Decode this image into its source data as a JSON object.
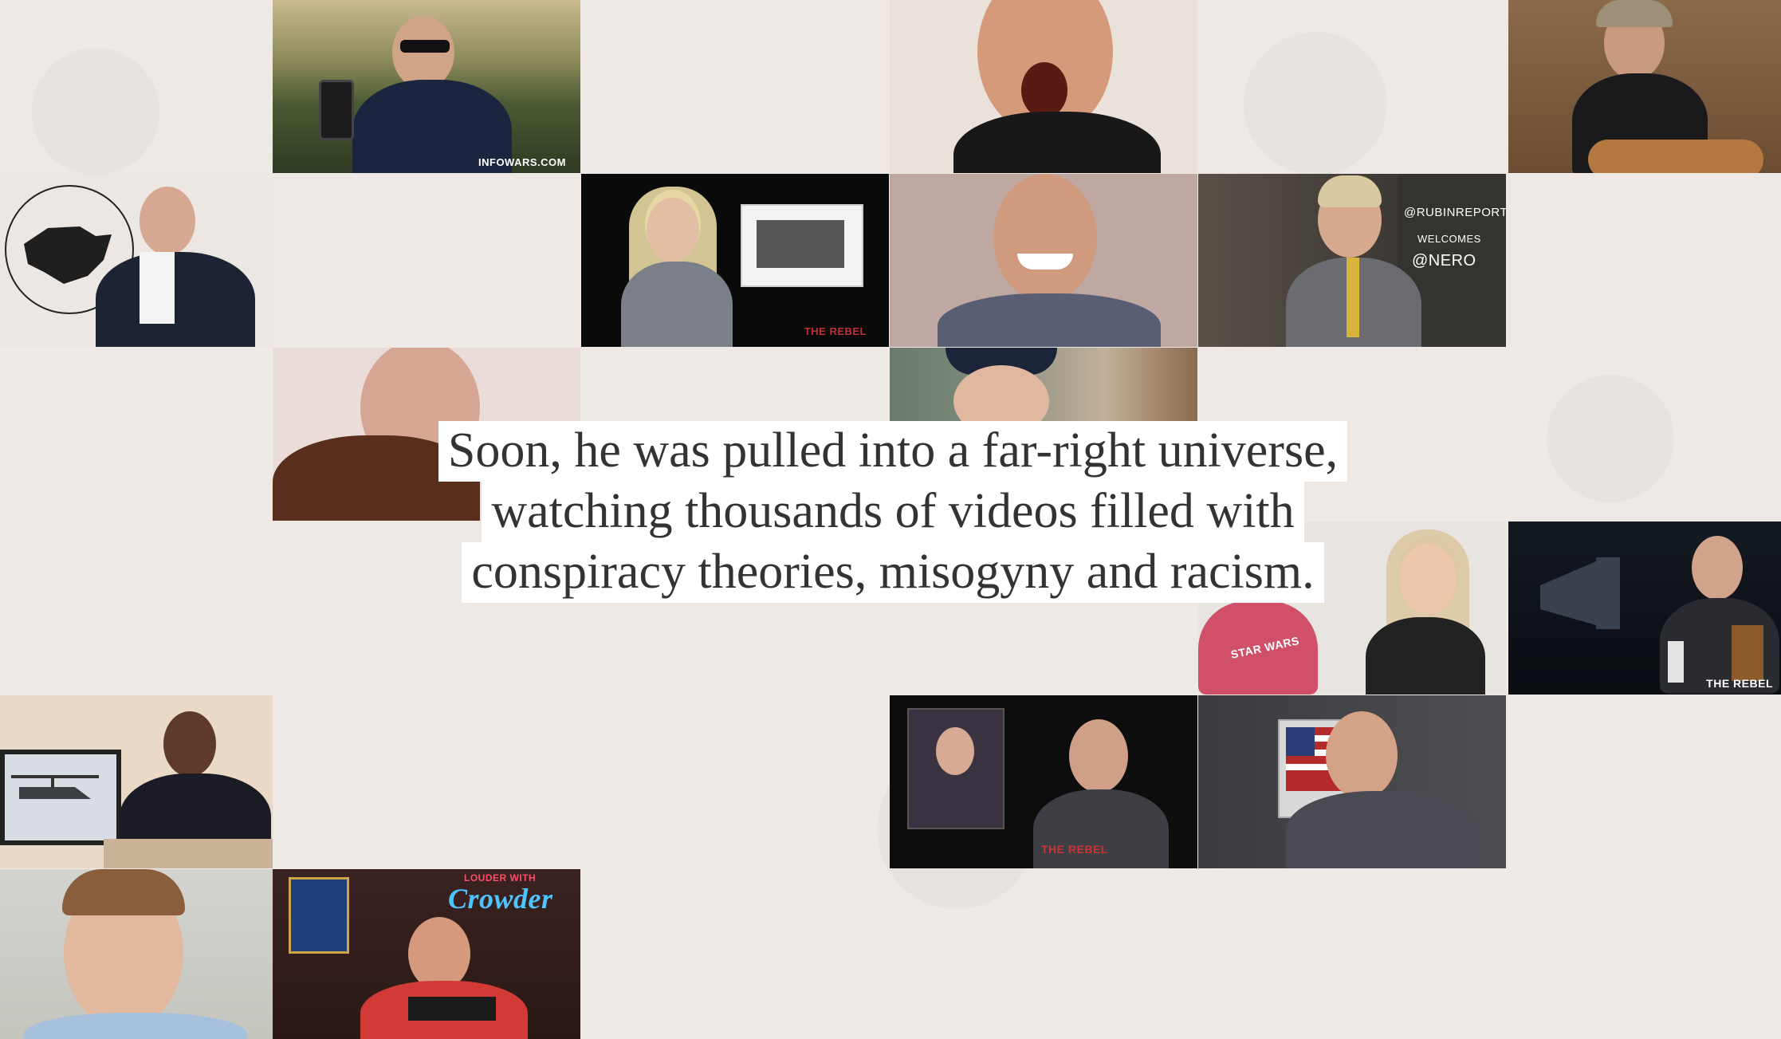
{
  "caption": {
    "line1": "Soon, he was pulled into a far-right universe,",
    "line2": "watching thousands of videos filled with",
    "line3": "conspiracy theories, misogyny and racism."
  },
  "tiles": {
    "infowars": {
      "watermark": "INFOWARS.COM"
    },
    "rebel_presenter": {
      "watermark": "THE REBEL"
    },
    "nero": {
      "sign_line1": "@RUBINREPORT",
      "sign_line2": "WELCOMES",
      "sign_line3": "@NERO"
    },
    "starwars": {
      "shirt": "STAR WARS"
    },
    "rebel_host": {
      "watermark": "THE REBEL"
    },
    "rebel_news": {
      "watermark": "THE REBEL"
    },
    "crowder": {
      "neon": "Crowder",
      "neon_top": "LOUDER WITH"
    }
  },
  "colors": {
    "background": "#efe9e6",
    "caption_bg": "#ffffff",
    "caption_text": "#333333"
  }
}
